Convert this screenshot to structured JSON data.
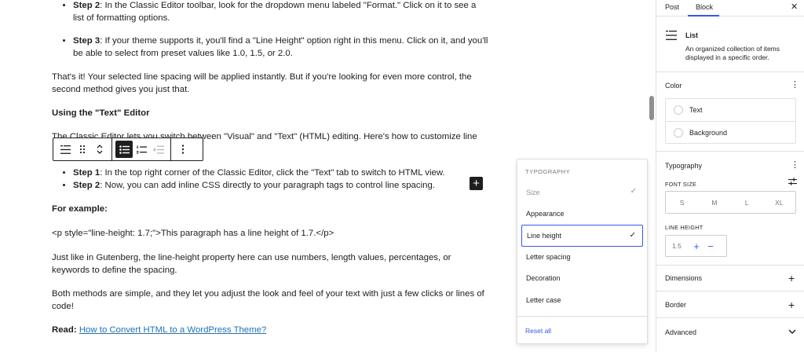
{
  "content": {
    "step2_format_bold": "Step 2",
    "step2_format_text": ": In the Classic Editor toolbar, look for the dropdown menu labeled \"Format.\" Click on it to see a list of formatting options.",
    "step3_bold": "Step 3",
    "step3_text": ": If your theme supports it, you'll find a \"Line Height\" option right in this menu. Click on it, and you'll be able to select from preset values like 1.0, 1.5, or 2.0.",
    "para_thats_it": "That's it! Your selected line spacing will be applied instantly. But if you're looking for even more control, the second method gives you just that.",
    "heading_text_editor": "Using the \"Text\" Editor",
    "para_classic_visible": "The Classic Editor lets you switch between \"Visual\" and \"Text\" (HTML) editing. Here's how to customize line",
    "step1_bold": "Step 1",
    "step1_text": ": In the top right corner of the Classic Editor, click the \"Text\" tab to switch to HTML view.",
    "step2_css_bold": "Step 2",
    "step2_css_text": ": Now, you can add inline CSS directly to your paragraph tags to control line spacing.",
    "for_example": "For example:",
    "code_example": "<p style=\"line-height: 1.7;\">This paragraph has a line height of 1.7.</p>",
    "para_gutenberg": "Just like in Gutenberg, the line-height property here can use numbers, length values, percentages, or keywords to define the spacing.",
    "para_both": "Both methods are simple, and they let you adjust the look and feel of your text with just a few clicks or lines of code!",
    "read_label": "Read:",
    "read_link": "How to Convert HTML to a WordPress Theme?"
  },
  "inserter": {
    "label": "+"
  },
  "typography_menu": {
    "heading": "TYPOGRAPHY",
    "items": [
      {
        "label": "Size",
        "checked": true,
        "disabled": true
      },
      {
        "label": "Appearance",
        "checked": false
      },
      {
        "label": "Line height",
        "checked": true,
        "focused": true
      },
      {
        "label": "Letter spacing",
        "checked": false
      },
      {
        "label": "Decoration",
        "checked": false
      },
      {
        "label": "Letter case",
        "checked": false
      }
    ],
    "check_glyph": "✓",
    "reset_all": "Reset all"
  },
  "sidebar": {
    "tabs": [
      "Post",
      "Block"
    ],
    "active_tab": "Block",
    "close_glyph": "✕",
    "block": {
      "title": "List",
      "description": "An organized collection of items displayed in a specific order."
    },
    "color": {
      "title": "Color",
      "menu_glyph": "⋮",
      "items": [
        "Text",
        "Background"
      ]
    },
    "typography": {
      "title": "Typography",
      "menu_glyph": "⋮",
      "font_size_label": "FONT SIZE",
      "font_sizes": [
        "S",
        "M",
        "L",
        "XL"
      ],
      "line_height_label": "LINE HEIGHT",
      "line_height_value": "1.5",
      "plus_glyph": "+",
      "minus_glyph": "−"
    },
    "dimensions": {
      "title": "Dimensions",
      "glyph": "+"
    },
    "border": {
      "title": "Border",
      "glyph": "+"
    },
    "advanced": {
      "title": "Advanced"
    }
  },
  "colors": {
    "accent": "#3858e9",
    "link": "#2271b1",
    "text": "#1e1e1e",
    "muted": "#757575"
  }
}
